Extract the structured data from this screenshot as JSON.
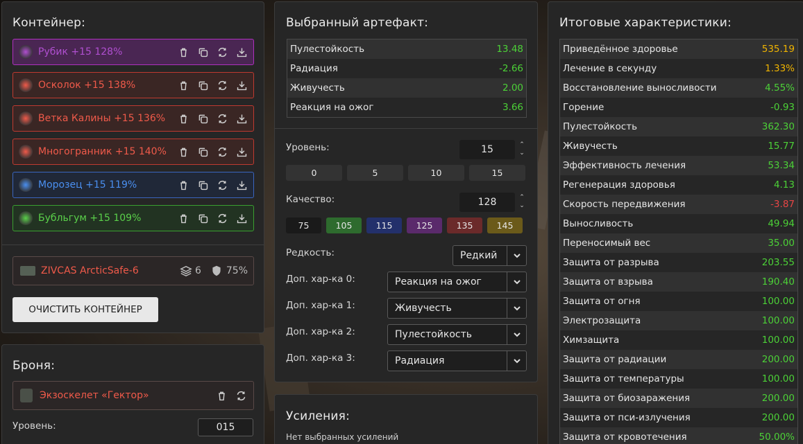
{
  "container": {
    "title": "Контейнер:",
    "items": [
      {
        "label": "Рубик +15 128%",
        "color": "#b04fd0",
        "border": "#b030c0",
        "bg": "#4a2653",
        "icon": "cube-icon"
      },
      {
        "label": "Осколок +15 138%",
        "color": "#f05a4a",
        "border": "#c03a30",
        "bg": "#3a2624",
        "icon": "shard-icon"
      },
      {
        "label": "Ветка Калины +15 136%",
        "color": "#f05a4a",
        "border": "#c03a30",
        "bg": "#3a2624",
        "icon": "branch-icon"
      },
      {
        "label": "Многогранник +15 140%",
        "color": "#f05a4a",
        "border": "#c03a30",
        "bg": "#3a2624",
        "icon": "polyhedron-icon"
      },
      {
        "label": "Морозец +15 119%",
        "color": "#4a8ff0",
        "border": "#3a66c0",
        "bg": "#202838",
        "icon": "frost-icon"
      },
      {
        "label": "Бубльгум +15 109%",
        "color": "#5ad04a",
        "border": "#3aa030",
        "bg": "#223322",
        "icon": "bubblegum-icon"
      }
    ],
    "case": {
      "name": "ZIVCAS ArcticSafe-6",
      "slots": "6",
      "protection": "75%"
    },
    "clear_button": "ОЧИСТИТЬ КОНТЕЙНЕР"
  },
  "armor": {
    "title": "Броня:",
    "item": "Экзоскелет «Гектор»",
    "level_label": "Уровень:",
    "level_value": "015"
  },
  "artifact": {
    "title": "Выбранный артефакт:",
    "stats": [
      {
        "name": "Пулестойкость",
        "value": "13.48"
      },
      {
        "name": "Радиация",
        "value": "-2.66"
      },
      {
        "name": "Живучесть",
        "value": "2.00"
      },
      {
        "name": "Реакция на ожог",
        "value": "3.66"
      }
    ],
    "level_label": "Уровень:",
    "level_value": "15",
    "level_presets": [
      "0",
      "5",
      "10",
      "15"
    ],
    "quality_label": "Качество:",
    "quality_value": "128",
    "quality_presets": [
      {
        "label": "75",
        "color": "#1a1a1a"
      },
      {
        "label": "105",
        "color": "#2e6b2e"
      },
      {
        "label": "115",
        "color": "#23306b"
      },
      {
        "label": "125",
        "color": "#5a2a6b"
      },
      {
        "label": "135",
        "color": "#6b2a2a"
      },
      {
        "label": "145",
        "color": "#6b5a1a"
      }
    ],
    "rarity_label": "Редкость:",
    "rarity_value": "Редкий",
    "extras": [
      {
        "label": "Доп. хар-ка 0:",
        "value": "Реакция на ожог"
      },
      {
        "label": "Доп. хар-ка 1:",
        "value": "Живучесть"
      },
      {
        "label": "Доп. хар-ка 2:",
        "value": "Пулестойкость"
      },
      {
        "label": "Доп. хар-ка 3:",
        "value": "Радиация"
      }
    ]
  },
  "boosts": {
    "title": "Усиления:",
    "empty": "Нет выбранных усилений"
  },
  "totals": {
    "title": "Итоговые характеристики:",
    "stats": [
      {
        "name": "Приведённое здоровье",
        "value": "535.19",
        "tone": "orange"
      },
      {
        "name": "Лечение в секунду",
        "value": "1.33%",
        "tone": "orange"
      },
      {
        "name": "Восстановление выносливости",
        "value": "4.55%",
        "tone": "green"
      },
      {
        "name": "Горение",
        "value": "-0.93",
        "tone": "green"
      },
      {
        "name": "Пулестойкость",
        "value": "362.30",
        "tone": "green"
      },
      {
        "name": "Живучесть",
        "value": "15.77",
        "tone": "green"
      },
      {
        "name": "Эффективность лечения",
        "value": "53.34",
        "tone": "green"
      },
      {
        "name": "Регенерация здоровья",
        "value": "4.13",
        "tone": "green"
      },
      {
        "name": "Скорость передвижения",
        "value": "-3.87",
        "tone": "red"
      },
      {
        "name": "Выносливость",
        "value": "49.94",
        "tone": "green"
      },
      {
        "name": "Переносимый вес",
        "value": "35.00",
        "tone": "green"
      },
      {
        "name": "Защита от разрыва",
        "value": "203.55",
        "tone": "green"
      },
      {
        "name": "Защита от взрыва",
        "value": "190.40",
        "tone": "green"
      },
      {
        "name": "Защита от огня",
        "value": "100.00",
        "tone": "green"
      },
      {
        "name": "Электрозащита",
        "value": "100.00",
        "tone": "green"
      },
      {
        "name": "Химзащита",
        "value": "100.00",
        "tone": "green"
      },
      {
        "name": "Защита от радиации",
        "value": "200.00",
        "tone": "green"
      },
      {
        "name": "Защита от температуры",
        "value": "100.00",
        "tone": "green"
      },
      {
        "name": "Защита от биозаражения",
        "value": "200.00",
        "tone": "green"
      },
      {
        "name": "Защита от пси-излучения",
        "value": "200.00",
        "tone": "green"
      },
      {
        "name": "Защита от кровотечения",
        "value": "50.00%",
        "tone": "green"
      }
    ]
  }
}
